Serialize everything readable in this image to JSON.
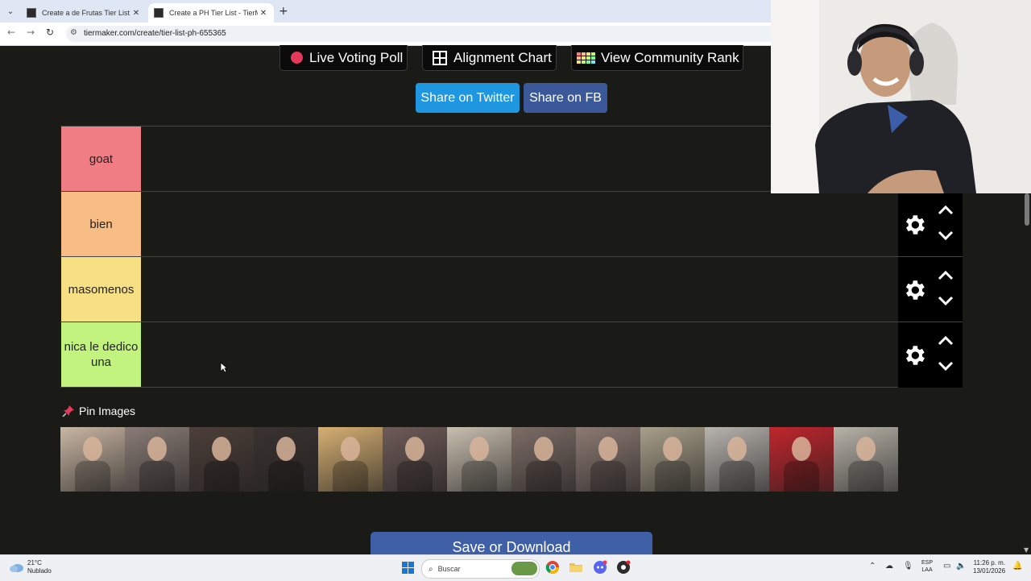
{
  "browser": {
    "tabs": [
      {
        "title": "Create a de Frutas Tier List - Tie",
        "active": false
      },
      {
        "title": "Create a PH Tier List - TierMake",
        "active": true
      }
    ],
    "url": "tiermaker.com/create/tier-list-ph-655365"
  },
  "toolbar": {
    "live_voting_poll": "Live Voting Poll",
    "alignment_chart": "Alignment Chart",
    "view_community_rank": "View Community Rank",
    "share_twitter": "Share on Twitter",
    "share_fb": "Share on FB"
  },
  "tiers": [
    {
      "label": "goat",
      "color": "#f07d84"
    },
    {
      "label": "bien",
      "color": "#f8bd84"
    },
    {
      "label": "masomenos",
      "color": "#f7df84"
    },
    {
      "label": "nica le dedico una",
      "color": "#c3f37f"
    }
  ],
  "pin_images": {
    "title": "Pin Images",
    "items": [
      {
        "name": "image-1",
        "color": "#c9b6a3"
      },
      {
        "name": "image-2",
        "color": "#8a7c76"
      },
      {
        "name": "image-3",
        "color": "#4d3f39"
      },
      {
        "name": "image-4",
        "color": "#3a3330"
      },
      {
        "name": "image-5",
        "color": "#d6b073"
      },
      {
        "name": "image-6",
        "color": "#6e5b58"
      },
      {
        "name": "image-7",
        "color": "#c9bfb0"
      },
      {
        "name": "image-8",
        "color": "#7d6d66"
      },
      {
        "name": "image-9",
        "color": "#8c7a73"
      },
      {
        "name": "image-10",
        "color": "#a9a08b"
      },
      {
        "name": "image-11",
        "color": "#b8b4ae"
      },
      {
        "name": "image-12",
        "color": "#c0262d"
      },
      {
        "name": "image-13",
        "color": "#b8b3a8"
      }
    ]
  },
  "save_button": "Save or Download",
  "taskbar": {
    "temperature": "21°C",
    "weather": "Nublado",
    "search_placeholder": "Buscar",
    "lang_top": "ESP",
    "lang_bottom": "LAA",
    "time": "11:26 p. m.",
    "date": "13/01/2026"
  }
}
